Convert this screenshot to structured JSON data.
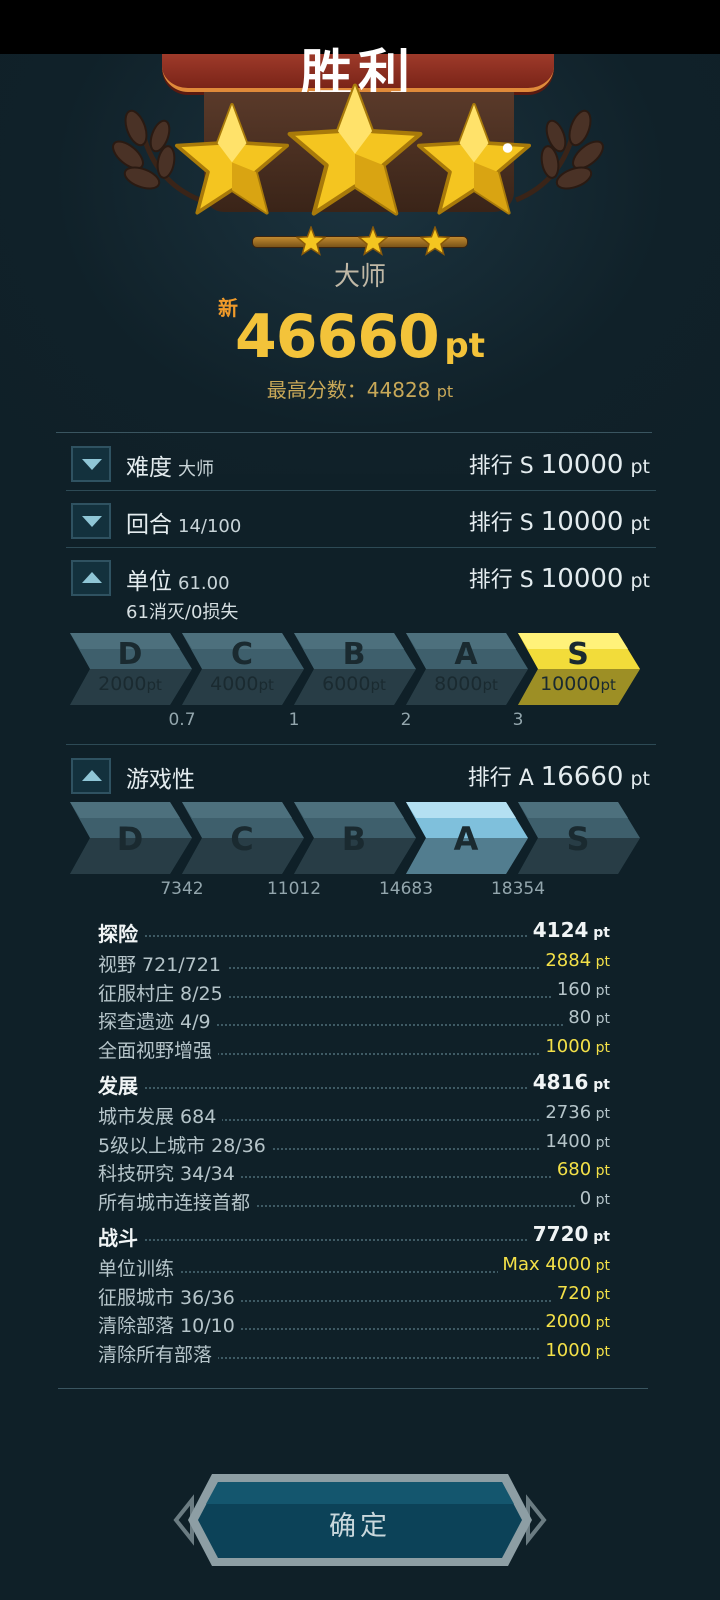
{
  "header": {
    "banner_text": "胜利",
    "rank_title": "大师",
    "new_tag": "新",
    "score": "46660",
    "score_unit": "pt",
    "best_label": "最高分数：",
    "best_value": "44828",
    "best_unit": "pt",
    "stars_earned": 3,
    "stars_total": 3
  },
  "rows": [
    {
      "label": "难度",
      "sub": "大师",
      "rank_prefix": "排行",
      "rank": "S",
      "points": "10000",
      "unit": "pt",
      "expanded": false
    },
    {
      "label": "回合",
      "sub": "14/100",
      "rank_prefix": "排行",
      "rank": "S",
      "points": "10000",
      "unit": "pt",
      "expanded": false
    },
    {
      "label": "单位",
      "sub": "61.00",
      "sub2": "61消灭/0损失",
      "rank_prefix": "排行",
      "rank": "S",
      "points": "10000",
      "unit": "pt",
      "expanded": true
    },
    {
      "label": "游戏性",
      "rank_prefix": "排行",
      "rank": "A",
      "points": "16660",
      "unit": "pt",
      "expanded": true
    }
  ],
  "units_grades": [
    {
      "letter": "D",
      "points": "2000",
      "unit": "pt",
      "active": false
    },
    {
      "letter": "C",
      "points": "4000",
      "unit": "pt",
      "active": false
    },
    {
      "letter": "B",
      "points": "6000",
      "unit": "pt",
      "active": false
    },
    {
      "letter": "A",
      "points": "8000",
      "unit": "pt",
      "active": false
    },
    {
      "letter": "S",
      "points": "10000",
      "unit": "pt",
      "active": true
    }
  ],
  "units_thresholds": [
    "0.7",
    "1",
    "2",
    "3"
  ],
  "gameplay_grades": [
    {
      "letter": "D",
      "active": false
    },
    {
      "letter": "C",
      "active": false
    },
    {
      "letter": "B",
      "active": false
    },
    {
      "letter": "A",
      "active": true
    },
    {
      "letter": "S",
      "active": false
    }
  ],
  "gameplay_thresholds": [
    "7342",
    "11012",
    "14683",
    "18354"
  ],
  "details": [
    {
      "label": "探险",
      "value": "4124",
      "unit": "pt",
      "head": true,
      "highlight": false
    },
    {
      "label": "视野  721/721",
      "value": "2884",
      "unit": "pt",
      "highlight": true
    },
    {
      "label": "征服村庄  8/25",
      "value": "160",
      "unit": "pt",
      "highlight": false
    },
    {
      "label": "探查遗迹  4/9",
      "value": "80",
      "unit": "pt",
      "highlight": false
    },
    {
      "label": "全面视野增强",
      "value": "1000",
      "unit": "pt",
      "highlight": true
    },
    {
      "label": "发展",
      "value": "4816",
      "unit": "pt",
      "head": true,
      "highlight": false
    },
    {
      "label": "城市发展  684",
      "value": "2736",
      "unit": "pt",
      "highlight": false
    },
    {
      "label": "5级以上城市  28/36",
      "value": "1400",
      "unit": "pt",
      "highlight": false
    },
    {
      "label": "科技研究  34/34",
      "value": "680",
      "unit": "pt",
      "highlight": true
    },
    {
      "label": "所有城市连接首都",
      "value": "0",
      "unit": "pt",
      "highlight": false
    },
    {
      "label": "战斗",
      "value": "7720",
      "unit": "pt",
      "head": true,
      "highlight": false
    },
    {
      "label": "单位训练",
      "value": "Max 4000",
      "unit": "pt",
      "highlight": true
    },
    {
      "label": "征服城市  36/36",
      "value": "720",
      "unit": "pt",
      "highlight": true
    },
    {
      "label": "清除部落  10/10",
      "value": "2000",
      "unit": "pt",
      "highlight": true
    },
    {
      "label": "清除所有部落",
      "value": "1000",
      "unit": "pt",
      "highlight": true
    }
  ],
  "confirm_label": "确定",
  "colors": {
    "background": "#0f2028",
    "score_gold": "#f3c33a",
    "highlight_yellow": "#f3e048",
    "grade_active_s": "#f2dc3a",
    "grade_active_a": "#7fc0dc",
    "grade_inactive": "#3e5f6c"
  }
}
